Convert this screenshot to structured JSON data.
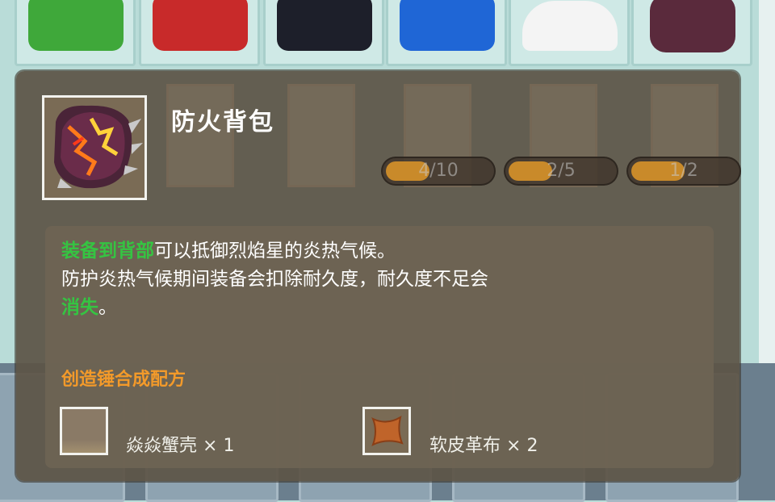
{
  "item": {
    "name": "防火背包",
    "icon": "fireproof-backpack-icon"
  },
  "progress_bars": [
    {
      "label": "4/10",
      "fraction": 0.4
    },
    {
      "label": "2/5",
      "fraction": 0.4
    },
    {
      "label": "1/2",
      "fraction": 0.5
    }
  ],
  "description": {
    "line1_highlight": "装备到背部",
    "line1_rest": "可以抵御烈焰星的炎热气候。",
    "line2": "防护炎热气候期间装备会扣除耐久度，耐久度不足会",
    "line3_highlight": "消失",
    "line3_rest": "。"
  },
  "recipe": {
    "title": "创造锤合成配方",
    "ingredients": [
      {
        "name": "焱焱蟹壳",
        "qty": "× 1",
        "icon": "crab-shell-icon"
      },
      {
        "name": "软皮革布",
        "qty": "× 2",
        "icon": "soft-leather-icon"
      }
    ]
  },
  "colors": {
    "highlight": "#35c442",
    "recipe_title": "#f39a2a",
    "panel": "#5c5446"
  }
}
